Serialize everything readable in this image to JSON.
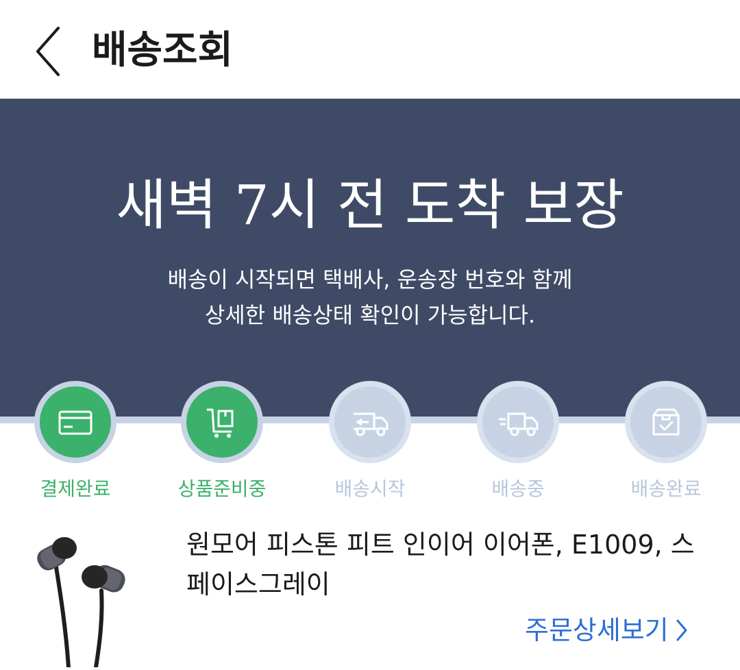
{
  "header": {
    "title": "배송조회",
    "back_icon": "chevron-left-icon"
  },
  "banner": {
    "title": "새벽 7시 전 도착 보장",
    "description_lines": [
      "배송이 시작되면 택배사, 운송장 번호와 함께",
      "상세한 배송상태 확인이 가능합니다."
    ]
  },
  "steps": [
    {
      "label": "결제완료",
      "icon": "credit-card-icon",
      "state": "done"
    },
    {
      "label": "상품준비중",
      "icon": "cart-box-icon",
      "state": "done"
    },
    {
      "label": "배송시작",
      "icon": "truck-start-icon",
      "state": "pending"
    },
    {
      "label": "배송중",
      "icon": "truck-moving-icon",
      "state": "pending"
    },
    {
      "label": "배송완료",
      "icon": "box-check-icon",
      "state": "pending"
    }
  ],
  "product": {
    "name": "원모어 피스톤 피트 인이어 이어폰, E1009, 스페이스그레이",
    "detail_link": "주문상세보기"
  },
  "colors": {
    "banner_bg": "#3f4b66",
    "done_green": "#3bb16b",
    "pending_blue": "#c7d3e5",
    "link_blue": "#2d6fd6"
  }
}
